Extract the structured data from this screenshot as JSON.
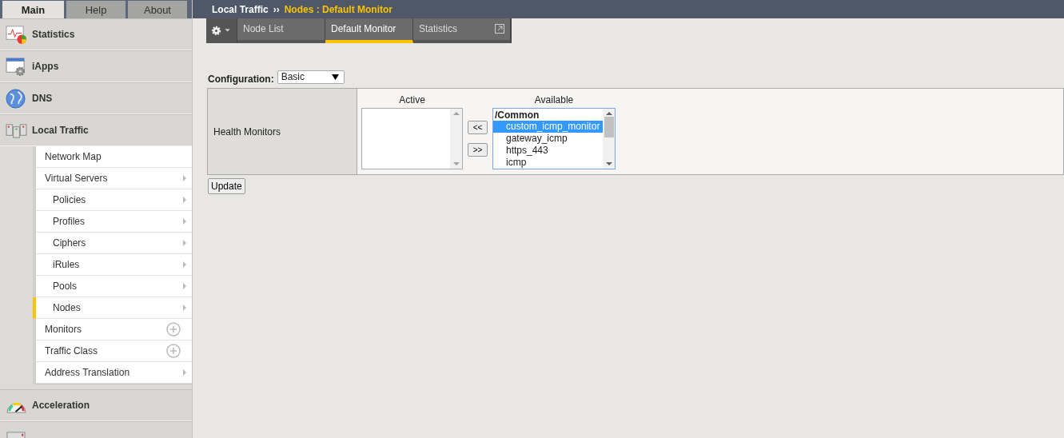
{
  "top_tabs": [
    {
      "label": "Main",
      "selected": true
    },
    {
      "label": "Help",
      "selected": false
    },
    {
      "label": "About",
      "selected": false
    }
  ],
  "breadcrumb": {
    "section": "Local Traffic",
    "separator": "››",
    "page": "Nodes : Default Monitor"
  },
  "sidebar": {
    "sections": [
      {
        "label": "Statistics"
      },
      {
        "label": "iApps"
      },
      {
        "label": "DNS"
      },
      {
        "label": "Local Traffic",
        "children": [
          {
            "label": "Network Map",
            "selected": false,
            "kind": "plain"
          },
          {
            "label": "Virtual Servers",
            "selected": false,
            "kind": "arrow",
            "children": [
              {
                "label": "Policies",
                "selected": false,
                "kind": "arrow"
              },
              {
                "label": "Profiles",
                "selected": false,
                "kind": "arrow"
              },
              {
                "label": "Ciphers",
                "selected": false,
                "kind": "arrow"
              },
              {
                "label": "iRules",
                "selected": false,
                "kind": "arrow"
              },
              {
                "label": "Pools",
                "selected": false,
                "kind": "arrow"
              },
              {
                "label": "Nodes",
                "selected": true,
                "kind": "arrow"
              }
            ]
          },
          {
            "label": "Monitors",
            "selected": false,
            "kind": "add"
          },
          {
            "label": "Traffic Class",
            "selected": false,
            "kind": "add"
          },
          {
            "label": "Address Translation",
            "selected": false,
            "kind": "arrow"
          }
        ]
      },
      {
        "label": "Acceleration"
      }
    ]
  },
  "page_tabs": [
    {
      "label": "Node List",
      "selected": false
    },
    {
      "label": "Default Monitor",
      "selected": true
    },
    {
      "label": "Statistics",
      "selected": false
    }
  ],
  "configuration": {
    "label": "Configuration:",
    "value": "Basic"
  },
  "health_monitors": {
    "label": "Health Monitors",
    "active_heading": "Active",
    "available_heading": "Available",
    "move_left": "<<",
    "move_right": ">>",
    "available_group": "/Common",
    "available": [
      {
        "label": "custom_icmp_monitor",
        "selected": true
      },
      {
        "label": "gateway_icmp",
        "selected": false
      },
      {
        "label": "https_443",
        "selected": false
      },
      {
        "label": "icmp",
        "selected": false
      }
    ]
  },
  "update_button": "Update"
}
